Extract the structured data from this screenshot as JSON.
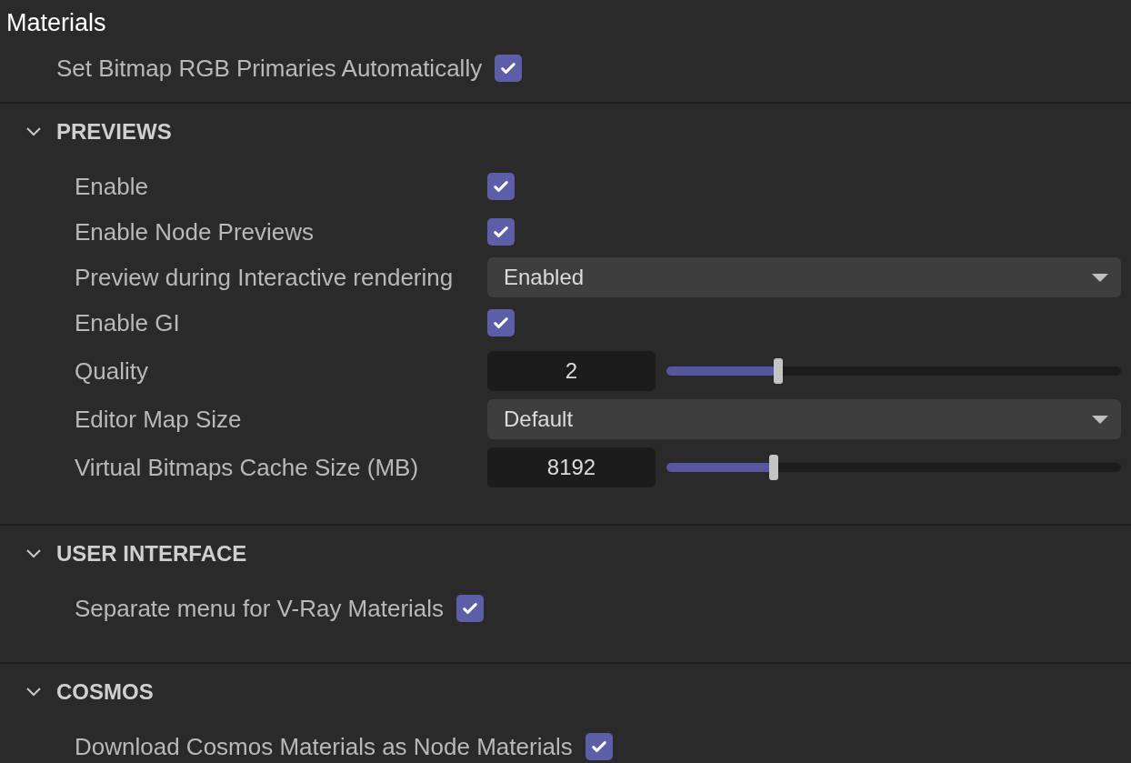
{
  "title": "Materials",
  "top_rows": [
    {
      "kind": "inline-checkbox",
      "label": "Set Bitmap RGB Primaries Automatically",
      "checked": true
    }
  ],
  "sections": [
    {
      "title": "PREVIEWS",
      "expanded": true,
      "rows": [
        {
          "kind": "checkbox",
          "label": "Enable",
          "checked": true
        },
        {
          "kind": "checkbox",
          "label": "Enable Node Previews",
          "checked": true
        },
        {
          "kind": "dropdown",
          "label": "Preview during Interactive rendering",
          "value": "Enabled"
        },
        {
          "kind": "checkbox",
          "label": "Enable GI",
          "checked": true
        },
        {
          "kind": "slider",
          "label": "Quality",
          "value": "2",
          "level": 0.245
        },
        {
          "kind": "dropdown",
          "label": "Editor Map Size",
          "value": "Default"
        },
        {
          "kind": "slider",
          "label": "Virtual Bitmaps Cache Size (MB)",
          "value": "8192",
          "level": 0.235
        }
      ]
    },
    {
      "title": "USER INTERFACE",
      "expanded": true,
      "rows": [
        {
          "kind": "inline-checkbox",
          "label": "Separate menu for V-Ray Materials",
          "checked": true
        }
      ]
    },
    {
      "title": "COSMOS",
      "expanded": true,
      "rows": [
        {
          "kind": "inline-checkbox",
          "label": "Download Cosmos Materials as Node Materials",
          "checked": true
        }
      ]
    }
  ]
}
